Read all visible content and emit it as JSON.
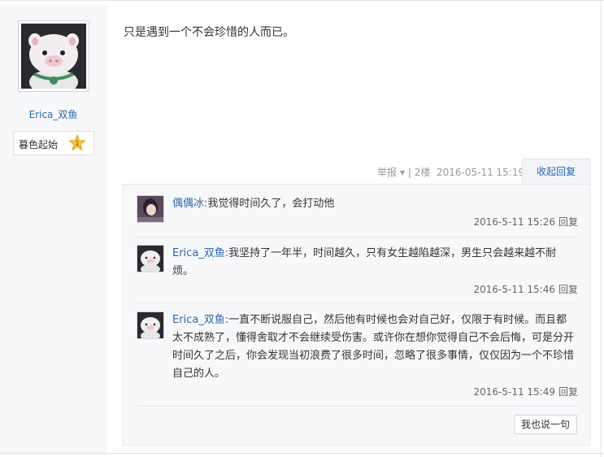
{
  "user": {
    "name": "Erica_双鱼",
    "level_title": "暮色起始",
    "level_number": "1"
  },
  "post": {
    "content": "只是遇到一个不会珍惜的人而已。",
    "report_label": "举报",
    "floor": "2楼",
    "timestamp": "2016-05-11 15:19",
    "collapse_label": "收起回复",
    "separator": "|"
  },
  "replies": [
    {
      "author": "偶偶冰:",
      "text": "我觉得时间久了，会打动他",
      "time": "2016-5-11 15:26",
      "reply_label": "回复"
    },
    {
      "author": "Erica_双鱼:",
      "text": "我坚持了一年半，时间越久，只有女生越陷越深，男生只会越来越不耐烦。",
      "time": "2016-5-11 15:46",
      "reply_label": "回复"
    },
    {
      "author": "Erica_双鱼:",
      "text": "一直不断说服自己，然后他有时候也会对自己好，仅限于有时候。而且都太不成熟了，懂得舍取才不会继续受伤害。或许你在想你觉得自己不会后悔，可是分开时间久了之后，你会发现当初浪费了很多时间，忽略了很多事情，仅仅因为一个不珍惜自己的人。",
      "time": "2016-5-11 15:49",
      "reply_label": "回复"
    }
  ],
  "say_button": "我也说一句",
  "colors": {
    "link": "#2d64b3",
    "panel_bg": "#f7f8fa",
    "badge": "#f5c33b"
  },
  "icons": {
    "level_badge": "star-badge-icon",
    "caret": "caret-down-icon"
  }
}
